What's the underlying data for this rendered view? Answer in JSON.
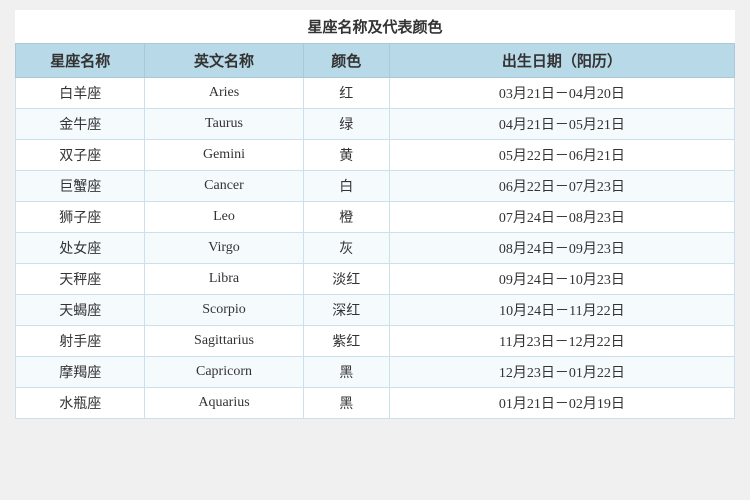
{
  "title": "星座名称及代表颜色",
  "headers": {
    "col1": "星座名称",
    "col2": "英文名称",
    "col3": "颜色",
    "col4": "出生日期（阳历）"
  },
  "rows": [
    {
      "zh": "白羊座",
      "en": "Aries",
      "color": "红",
      "date": "03月21日－04月20日"
    },
    {
      "zh": "金牛座",
      "en": "Taurus",
      "color": "绿",
      "date": "04月21日－05月21日"
    },
    {
      "zh": "双子座",
      "en": "Gemini",
      "color": "黄",
      "date": "05月22日－06月21日"
    },
    {
      "zh": "巨蟹座",
      "en": "Cancer",
      "color": "白",
      "date": "06月22日－07月23日"
    },
    {
      "zh": "狮子座",
      "en": "Leo",
      "color": "橙",
      "date": "07月24日－08月23日"
    },
    {
      "zh": "处女座",
      "en": "Virgo",
      "color": "灰",
      "date": "08月24日－09月23日"
    },
    {
      "zh": "天秤座",
      "en": "Libra",
      "color": "淡红",
      "date": "09月24日－10月23日"
    },
    {
      "zh": "天蝎座",
      "en": "Scorpio",
      "color": "深红",
      "date": "10月24日－11月22日"
    },
    {
      "zh": "射手座",
      "en": "Sagittarius",
      "color": "紫红",
      "date": "11月23日－12月22日"
    },
    {
      "zh": "摩羯座",
      "en": "Capricorn",
      "color": "黑",
      "date": "12月23日－01月22日"
    },
    {
      "zh": "水瓶座",
      "en": "Aquarius",
      "color": "黑",
      "date": "01月21日－02月19日"
    }
  ]
}
